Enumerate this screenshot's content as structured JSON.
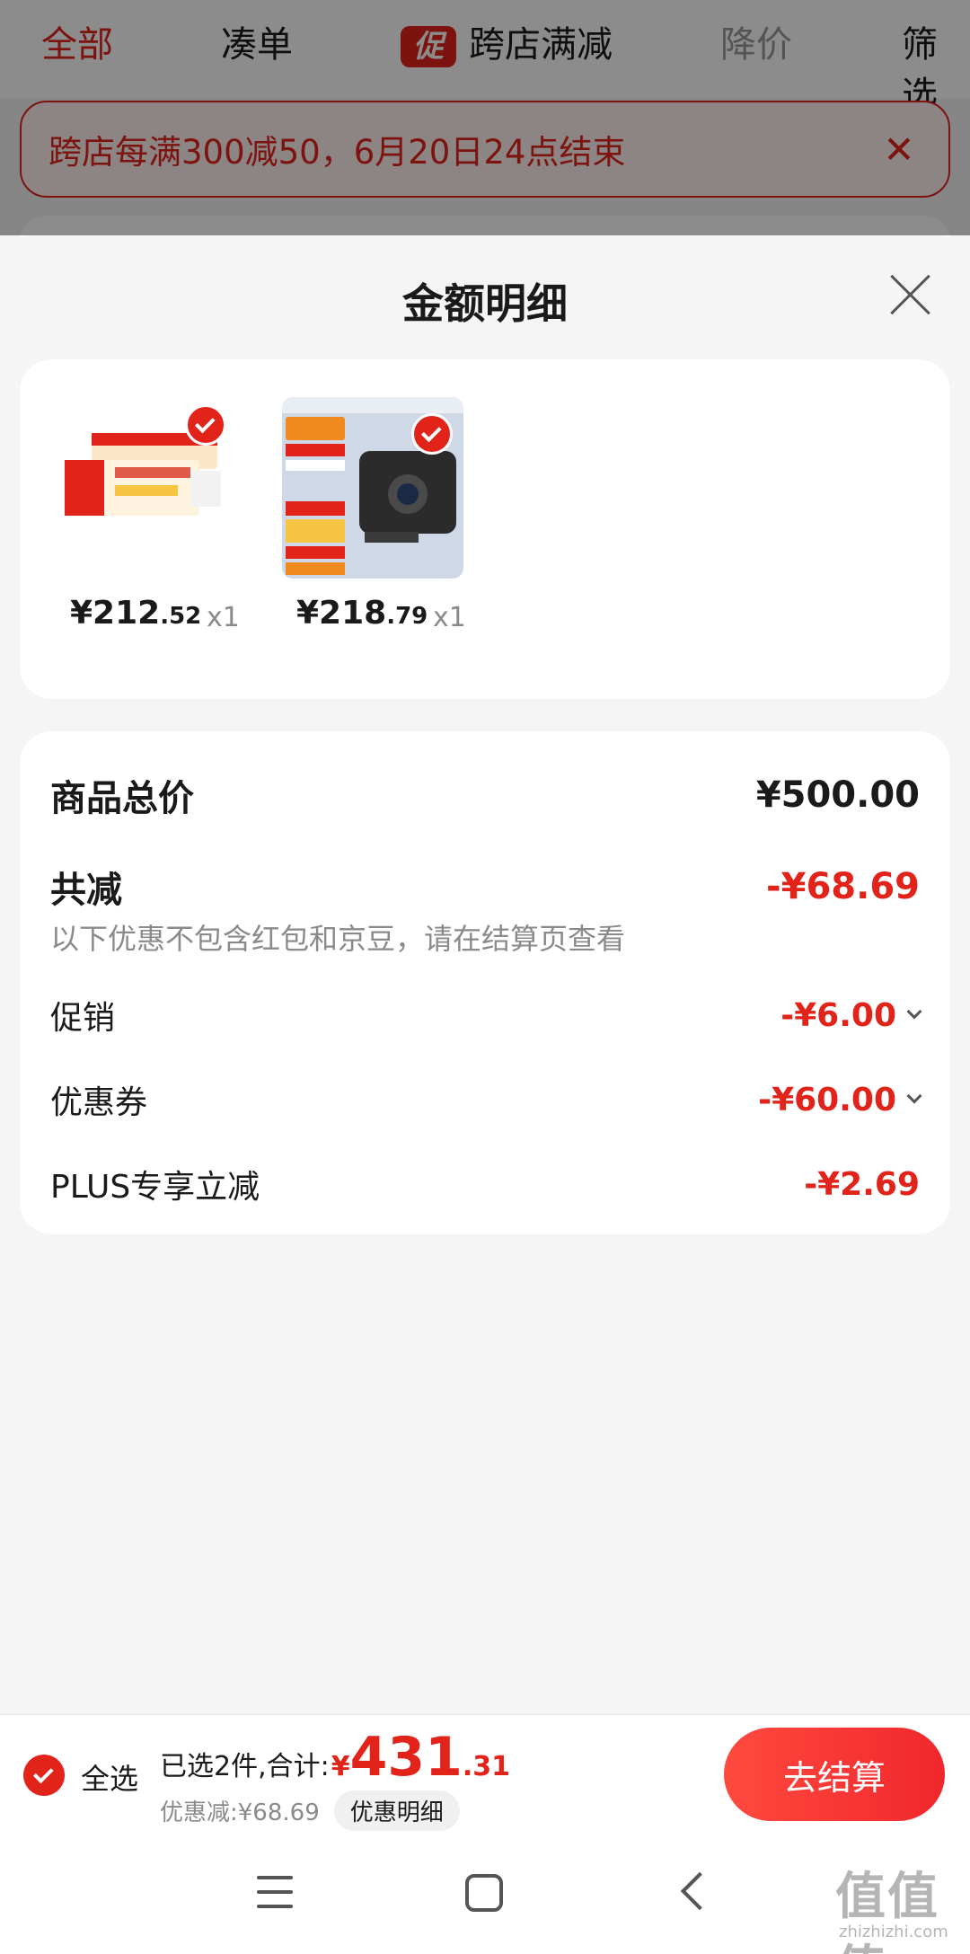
{
  "top_tabs": {
    "all": "全部",
    "combine": "凑单",
    "promo_icon": "促",
    "cross_store": "跨店满减",
    "price_drop": "降价",
    "filter": "筛选"
  },
  "banner": {
    "text": "跨店每满300减50，6月20日24点结束",
    "close_icon": "close-icon"
  },
  "sheet": {
    "title": "金额明细"
  },
  "products": [
    {
      "price_int": "¥212",
      "price_dec": ".52",
      "qty": "x1",
      "thumb_colors": [
        "#ffffff",
        "#e2231a",
        "#f6c542"
      ]
    },
    {
      "price_int": "¥218",
      "price_dec": ".79",
      "qty": "x1",
      "thumb_colors": [
        "#cfd8e6",
        "#2b2b2b",
        "#f08a1e"
      ]
    }
  ],
  "summary": {
    "total_label": "商品总价",
    "total_value": "¥500.00",
    "reduce_label": "共减",
    "reduce_value": "-¥68.69",
    "note": "以下优惠不包含红包和京豆，请在结算页查看",
    "promo_label": "促销",
    "promo_value": "-¥6.00",
    "coupon_label": "优惠券",
    "coupon_value": "-¥60.00",
    "plus_label": "PLUS专享立减",
    "plus_value": "-¥2.69"
  },
  "checkout": {
    "select_all": "全选",
    "selected_text": "已选2件,合计:",
    "total_yen": "¥",
    "total_int": "431",
    "total_dec": ".31",
    "discount_text": "优惠减:¥68.69",
    "detail_button": "优惠明细",
    "checkout_button": "去结算"
  },
  "watermark": {
    "main": "值值值",
    "sub": "zhizhizhi.com"
  },
  "colors": {
    "accent": "#e2231a",
    "background": "#f5f5f5"
  }
}
